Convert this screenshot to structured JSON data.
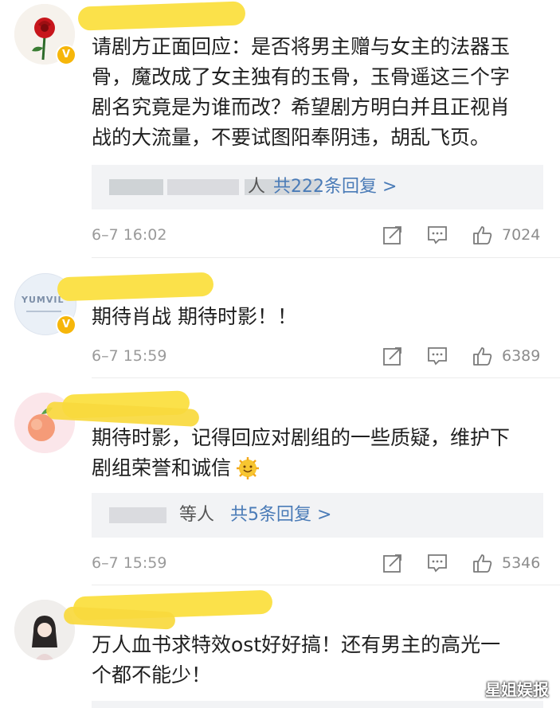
{
  "comments": [
    {
      "lines": [
        "请剧方正面回应：是否将男主赠与女主的法器玉",
        "骨，魔改成了女主独有的玉骨，玉骨遥这三个字",
        "剧名究竟是为谁而改？希望剧方明白并且正视肖",
        "战的大流量，不要试图阳奉阴违，胡乱飞页。"
      ],
      "reply_prefix": "人",
      "reply_count": "共222条回复 >",
      "time": "6–7 16:02",
      "likes": "7024"
    },
    {
      "avatar_text": "YUMVIL",
      "lines": [
        "期待肖战 期待时影！！"
      ],
      "time": "6–7 15:59",
      "likes": "6389"
    },
    {
      "lines": [
        "期待时影，记得回应对剧组的一些质疑，维护下",
        "剧组荣誉和诚信"
      ],
      "reply_prefix": "等人",
      "reply_count": "共5条回复 >",
      "time": "6–7 15:59",
      "likes": "5346"
    },
    {
      "lines": [
        "万人血书求特效ost好好搞！还有男主的高光一",
        "个都不能少！"
      ]
    }
  ],
  "icons": {
    "share": "share-icon",
    "comment": "comment-icon",
    "like": "thumbs-up-icon",
    "verified": "verified-badge-icon",
    "emoji": "smile-emoji-icon"
  },
  "colors": {
    "link": "#4a7bb7",
    "meta": "#9a9a9a",
    "badge": "#f6b60a",
    "highlight": "#fbe14a"
  },
  "watermark": "星姐娱报"
}
